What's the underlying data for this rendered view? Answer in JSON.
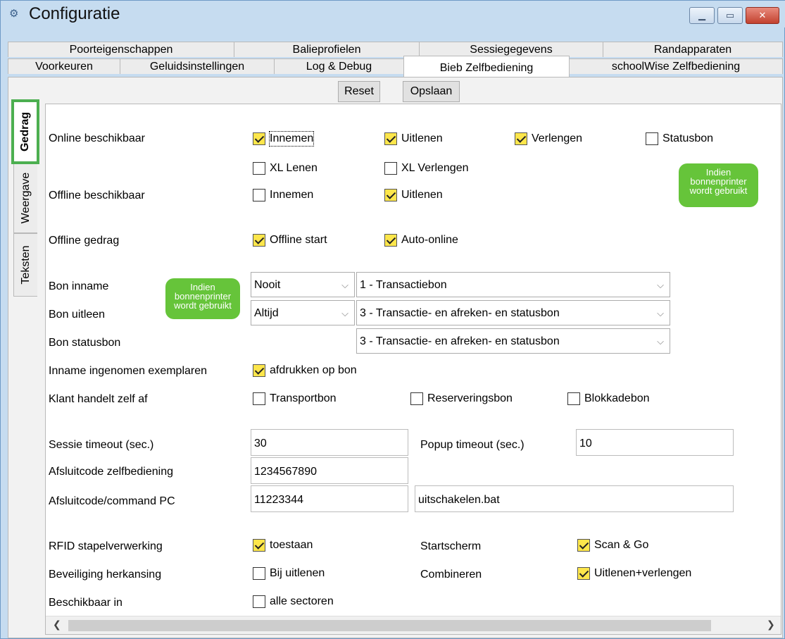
{
  "window": {
    "title": "Configuratie",
    "app_icon": "gears-icon",
    "controls": [
      "minimize-icon",
      "maximize-icon",
      "close-icon"
    ]
  },
  "tabs_row1": [
    "Poorteigenschappen",
    "Balieprofielen",
    "Sessiegegevens",
    "Randapparaten"
  ],
  "tabs_row2": [
    "Voorkeuren",
    "Geluidsinstellingen",
    "Log & Debug",
    "Bieb Zelfbediening",
    "schoolWise Zelfbediening"
  ],
  "active_tab": "Bieb Zelfbediening",
  "toolbar": {
    "reset": "Reset",
    "save": "Opslaan"
  },
  "vertical_tabs": [
    "Gedrag",
    "Weergave",
    "Teksten"
  ],
  "active_vertical_tab": "Gedrag",
  "form": {
    "online": {
      "label": "Online beschikbaar",
      "innemen": {
        "label": "Innemen",
        "checked": true
      },
      "uitlenen": {
        "label": "Uitlenen",
        "checked": true
      },
      "verlengen": {
        "label": "Verlengen",
        "checked": true
      },
      "statusbon": {
        "label": "Statusbon",
        "checked": false
      },
      "xl_lenen": {
        "label": "XL Lenen",
        "checked": false
      },
      "xl_verlengen": {
        "label": "XL Verlengen",
        "checked": false
      }
    },
    "tooltip_printer": [
      "Indien",
      "bonnenprinter",
      "wordt gebruikt"
    ],
    "offline": {
      "label": "Offline beschikbaar",
      "innemen": {
        "label": "Innemen",
        "checked": false
      },
      "uitlenen": {
        "label": "Uitlenen",
        "checked": true
      }
    },
    "offline_gedrag": {
      "label": "Offline gedrag",
      "offline_start": {
        "label": "Offline start",
        "checked": true
      },
      "auto_online": {
        "label": "Auto-online",
        "checked": true
      }
    },
    "bon_inname": {
      "label": "Bon inname",
      "when": "Nooit",
      "type": "1 - Transactiebon"
    },
    "bon_uitleen": {
      "label": "Bon uitleen",
      "when": "Altijd",
      "type": "3 - Transactie- en afreken- en statusbon"
    },
    "bon_statusbon": {
      "label": "Bon statusbon",
      "type": "3 - Transactie- en afreken- en statusbon"
    },
    "inname_ingenomen": {
      "label": "Inname ingenomen exemplaren",
      "afdrukken": {
        "label": "afdrukken op bon",
        "checked": true
      }
    },
    "klant_handelt": {
      "label": "Klant handelt zelf af",
      "transportbon": {
        "label": "Transportbon",
        "checked": false
      },
      "reserveringsbon": {
        "label": "Reserveringsbon",
        "checked": false
      },
      "blokkadebon": {
        "label": "Blokkadebon",
        "checked": false
      }
    },
    "sessie_timeout": {
      "label": "Sessie timeout (sec.)",
      "value": "30"
    },
    "popup_timeout": {
      "label": "Popup timeout (sec.)",
      "value": "10"
    },
    "afsluitcode_zelf": {
      "label": "Afsluitcode zelfbediening",
      "value": "1234567890"
    },
    "afsluitcode_pc": {
      "label": "Afsluitcode/command PC",
      "value": "11223344",
      "command": "uitschakelen.bat"
    },
    "rfid": {
      "label": "RFID stapelverwerking",
      "toestaan": {
        "label": "toestaan",
        "checked": true
      }
    },
    "startscherm": {
      "label": "Startscherm",
      "scan_go": {
        "label": "Scan & Go",
        "checked": true
      }
    },
    "beveiliging": {
      "label": "Beveiliging herkansing",
      "bij_uitlenen": {
        "label": "Bij uitlenen",
        "checked": false
      }
    },
    "combineren": {
      "label": "Combineren",
      "uitlenen_verlengen": {
        "label": "Uitlenen+verlengen",
        "checked": true
      }
    },
    "beschikbaar_in": {
      "label": "Beschikbaar in",
      "alle_sectoren": {
        "label": "alle sectoren",
        "checked": false
      }
    }
  },
  "colors": {
    "check_fill": "#fde64b",
    "tooltip_bg": "#66c43a",
    "highlight_tab": "#4caf50",
    "titlebar_bg": "#c6dcf0"
  }
}
